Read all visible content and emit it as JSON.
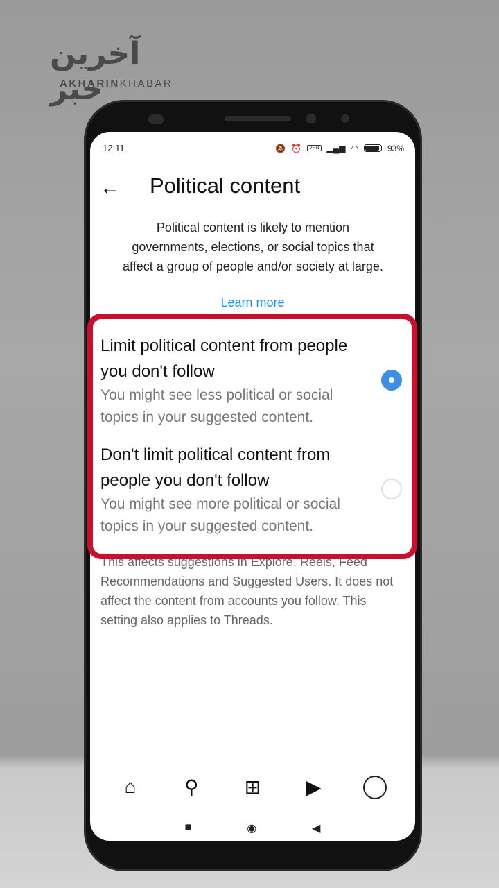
{
  "watermark": {
    "logo": "آخرین خبر",
    "text_bold": "AKHARIN",
    "text_light": "KHABAR"
  },
  "status": {
    "time": "12:11",
    "vpn": "VPN",
    "battery": "93%",
    "battery_level": 0.93
  },
  "header": {
    "back_icon": "arrow-left-icon",
    "title": "Political content"
  },
  "description": "Political content is likely to mention governments, elections, or social topics that affect a group of people and/or society at large.",
  "learn_more": "Learn more",
  "options": [
    {
      "title": "Limit political content from people you don't follow",
      "subtitle": "You might see less political or social topics in your suggested content.",
      "selected": true
    },
    {
      "title": "Don't limit political content from people you don't follow",
      "subtitle": "You might see more political or social topics in your suggested content.",
      "selected": false
    }
  ],
  "note": "This affects suggestions in Explore, Reels, Feed Recommendations and Suggested Users. It does not affect the content from accounts you follow. This setting also applies to Threads.",
  "colors": {
    "highlight": "#c8102e",
    "accent": "#3b8fe6",
    "link": "#1a8fe0"
  },
  "bottom_nav": [
    "home-icon",
    "search-icon",
    "create-icon",
    "reels-icon",
    "profile-avatar"
  ]
}
